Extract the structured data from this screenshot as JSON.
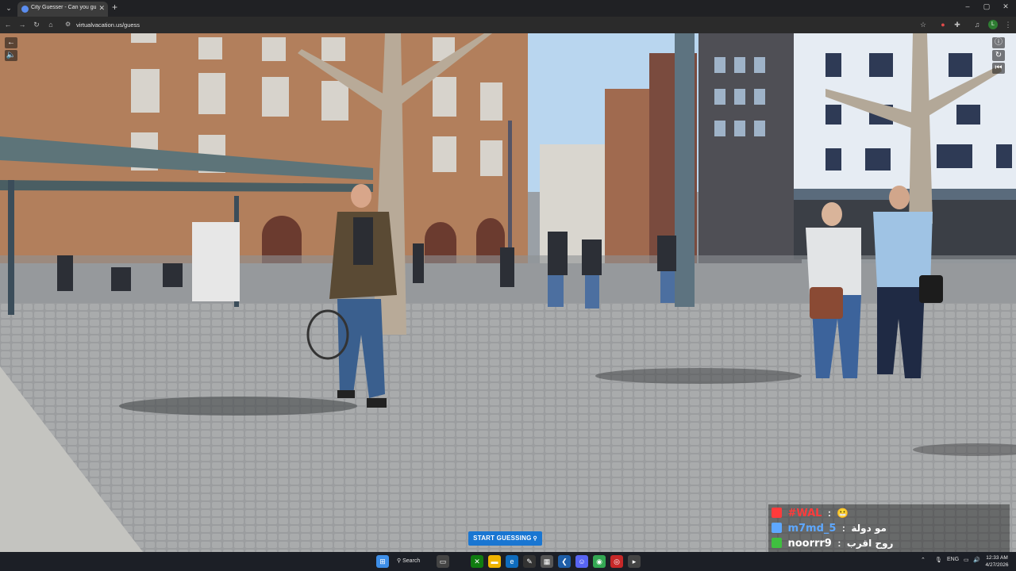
{
  "browser": {
    "tab_title": "City Guesser - Can you guess w",
    "url": "virtualvacation.us/guess",
    "new_tab_label": "+",
    "minimize": "–",
    "maximize": "▢",
    "close": "✕"
  },
  "game": {
    "start_button": "START GUESSING",
    "pin_icon": "⚲"
  },
  "chat": [
    {
      "user": "#WAL",
      "sep": ":",
      "message": "😬",
      "color": "#ff3b3b"
    },
    {
      "user": "m7md_5",
      "sep": ":",
      "message": "مو دولة",
      "color": "#5ea8ff"
    },
    {
      "user": "noorrr9",
      "sep": ":",
      "message": "روح اقرب",
      "color": "#ffffff"
    }
  ],
  "taskbar": {
    "search_label": "Search",
    "tray_lang": "ENG",
    "time": "12:33 AM",
    "date": "4/27/2026"
  }
}
